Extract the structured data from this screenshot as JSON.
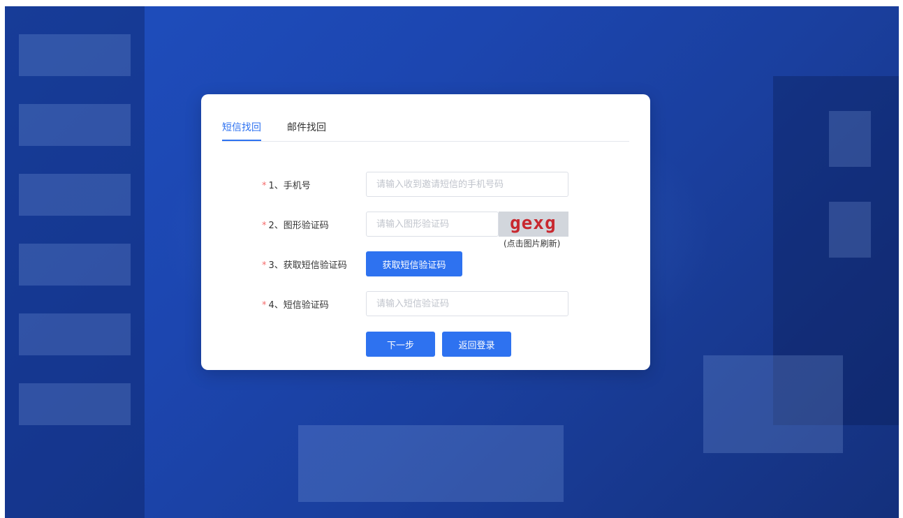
{
  "tabs": [
    {
      "label": "短信找回",
      "active": true
    },
    {
      "label": "邮件找回",
      "active": false
    }
  ],
  "form": {
    "required_mark": "*",
    "phone": {
      "label": "1、手机号",
      "placeholder": "请输入收到邀请短信的手机号码",
      "value": ""
    },
    "captcha": {
      "label": "2、图形验证码",
      "placeholder": "请输入图形验证码",
      "value": "",
      "image_text": "gexg",
      "hint": "(点击图片刷新)"
    },
    "sms_button": {
      "label": "3、获取短信验证码",
      "button": "获取短信验证码"
    },
    "sms_code": {
      "label": "4、短信验证码",
      "placeholder": "请输入短信验证码",
      "value": ""
    }
  },
  "actions": {
    "next": "下一步",
    "back_to_login": "返回登录"
  },
  "colors": {
    "primary": "#2e72f0",
    "required": "#f56c6c",
    "captcha_text": "#c8282f",
    "background": "#1c46b0"
  }
}
